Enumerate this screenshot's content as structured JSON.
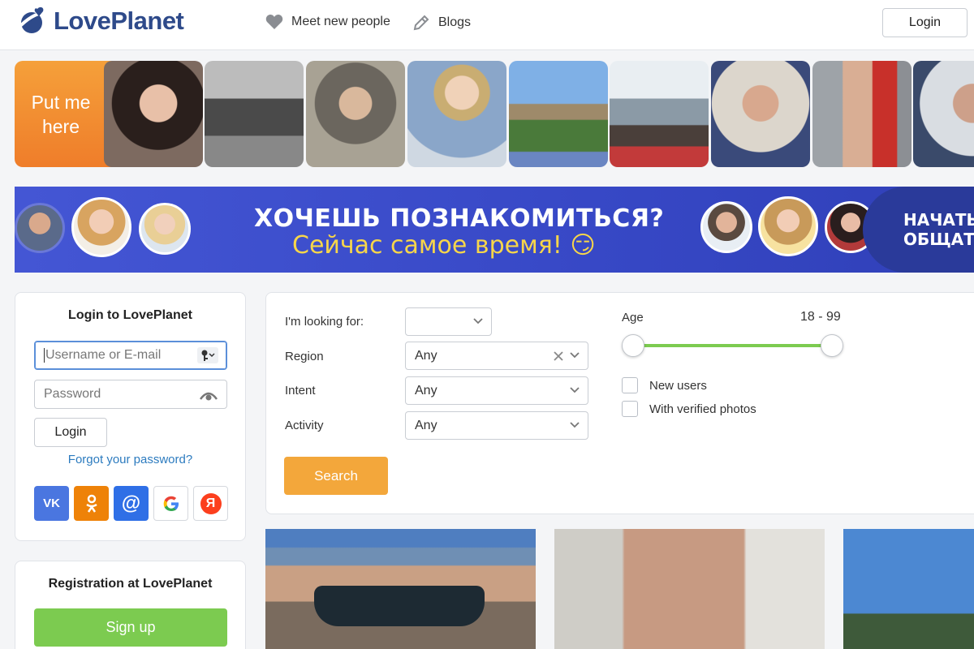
{
  "header": {
    "logo_text": "LovePlanet",
    "nav": [
      {
        "label": "Meet new people",
        "icon": "heart-icon"
      },
      {
        "label": "Blogs",
        "icon": "pencil-icon"
      }
    ],
    "login_label": "Login"
  },
  "strip": {
    "put_me_here": "Put me here"
  },
  "banner": {
    "title": "ХОЧЕШЬ ПОЗНАКОМИТЬСЯ?",
    "subtitle": "Сейчас самое время! 😏",
    "cta": "НАЧАТЬ ОБЩАТЬ"
  },
  "login_card": {
    "title": "Login to LovePlanet",
    "username_placeholder": "Username or E-mail",
    "password_placeholder": "Password",
    "login_button": "Login",
    "forgot_link": "Forgot your password?",
    "social": [
      {
        "name": "vk",
        "label": "VK",
        "color": "#4a76e0"
      },
      {
        "name": "odnoklassniki",
        "label": "OK",
        "color": "#ee8208"
      },
      {
        "name": "mail",
        "label": "@",
        "color": "#2f6fe6"
      },
      {
        "name": "google",
        "label": "G",
        "color": "#ffffff"
      },
      {
        "name": "yandex",
        "label": "Я",
        "color": "#ffffff"
      }
    ]
  },
  "registration_card": {
    "title": "Registration at LovePlanet",
    "signup_button": "Sign up"
  },
  "search": {
    "looking_for_label": "I'm looking for:",
    "looking_for_value": "",
    "region_label": "Region",
    "region_value": "Any",
    "intent_label": "Intent",
    "intent_value": "Any",
    "activity_label": "Activity",
    "activity_value": "Any",
    "search_button": "Search",
    "age_label": "Age",
    "age_range": "18 - 99",
    "age_min": 18,
    "age_max": 99,
    "new_users_label": "New users",
    "verified_label": "With verified photos"
  },
  "colors": {
    "brand": "#2e4a8a",
    "accent_orange": "#f3a73b",
    "signup_green": "#7ccb50",
    "slider_green": "#7ccb50",
    "link_blue": "#2c7bbf"
  }
}
